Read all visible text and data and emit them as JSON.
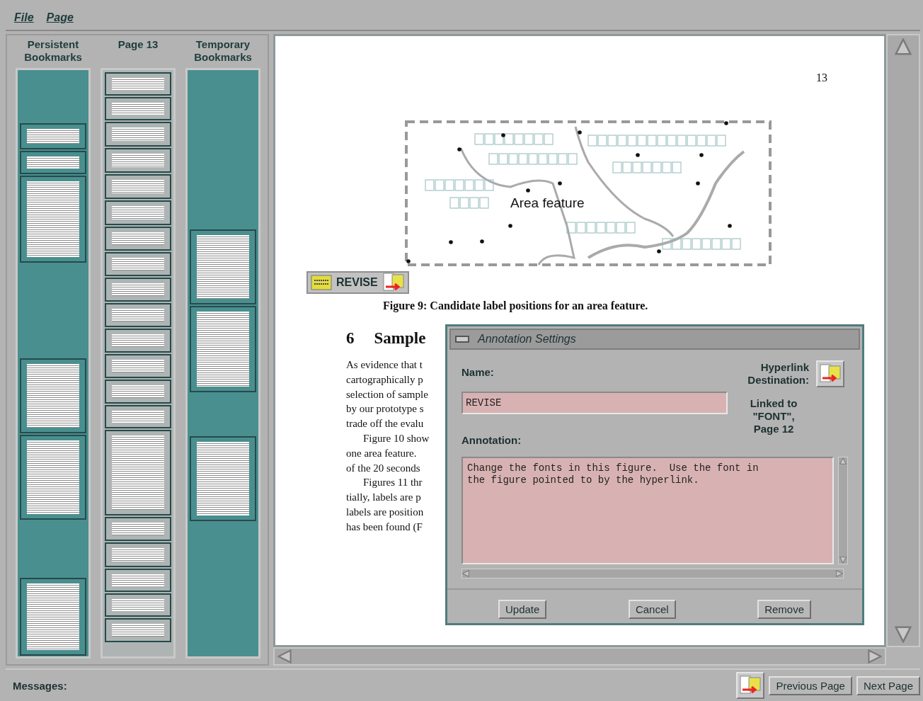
{
  "menu": [
    {
      "label": "File"
    },
    {
      "label": "Page"
    }
  ],
  "bookmark_panel": {
    "columns": [
      {
        "kind": "persistent",
        "title": "Persistent Bookmarks"
      },
      {
        "kind": "pages",
        "title": "Page 13"
      },
      {
        "kind": "temporary",
        "title": "Temporary Bookmarks"
      }
    ]
  },
  "page": {
    "page_number": "13",
    "figure": {
      "label_text": "Area feature",
      "caption": "Figure 9: Candidate label positions for an area feature."
    },
    "annotation_marker": {
      "label": "REVISE"
    },
    "section": {
      "number": "6",
      "title": "Sample"
    },
    "paragraphs": [
      [
        "As evidence that t",
        "cartographically p",
        "selection of sample",
        "by our prototype s",
        "trade off the evalu"
      ],
      [
        "Figure 10 show",
        "one area feature.",
        "of the 20 seconds"
      ],
      [
        "Figures 11 thr",
        "tially, labels are p",
        "labels are position",
        "has been found (F"
      ]
    ]
  },
  "dialog": {
    "title": "Annotation Settings",
    "name_label": "Name:",
    "name_value": "REVISE",
    "hyperlink_label": "Hyperlink Destination:",
    "link_info": "Linked to \"FONT\", Page 12",
    "annotation_label": "Annotation:",
    "annotation_value": "Change the fonts in this figure.  Use the font in\nthe figure pointed to by the hyperlink.",
    "buttons": [
      "Update",
      "Cancel",
      "Remove"
    ]
  },
  "status_bar": {
    "messages_label": "Messages:",
    "buttons": [
      "Previous Page",
      "Next Page"
    ]
  }
}
